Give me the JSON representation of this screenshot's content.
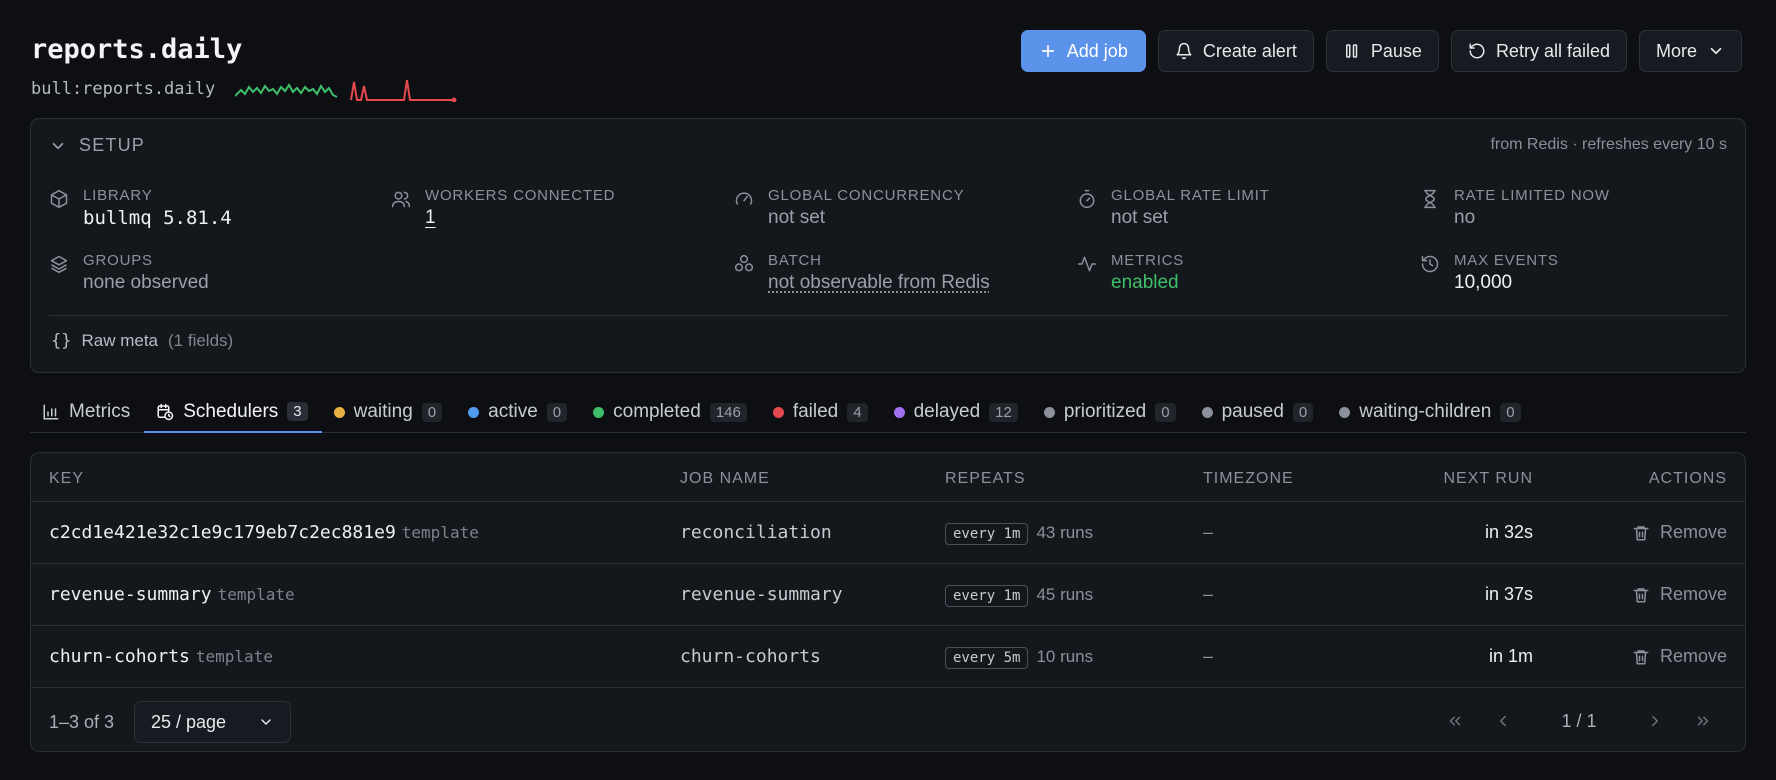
{
  "header": {
    "title": "reports.daily",
    "queue_key": "bull:reports.daily"
  },
  "actions": {
    "add_job": "Add job",
    "create_alert": "Create alert",
    "pause": "Pause",
    "retry_failed": "Retry all failed",
    "more": "More"
  },
  "setup": {
    "title": "SETUP",
    "note": "from Redis · refreshes every 10 s",
    "items": [
      {
        "label": "LIBRARY",
        "value": "bullmq 5.81.4",
        "icon": "package-icon"
      },
      {
        "label": "WORKERS CONNECTED",
        "value": "1",
        "icon": "users-icon"
      },
      {
        "label": "GLOBAL CONCURRENCY",
        "value": "not set",
        "icon": "gauge-icon"
      },
      {
        "label": "GLOBAL RATE LIMIT",
        "value": "not set",
        "icon": "timer-icon"
      },
      {
        "label": "RATE LIMITED NOW",
        "value": "no",
        "icon": "hourglass-icon"
      },
      {
        "label": "GROUPS",
        "value": "none observed",
        "icon": "layers-icon"
      },
      {
        "label": "BATCH",
        "value": "not observable from Redis",
        "icon": "boxes-icon"
      },
      {
        "label": "METRICS",
        "value": "enabled",
        "icon": "activity-icon"
      },
      {
        "label": "MAX EVENTS",
        "value": "10,000",
        "icon": "history-icon"
      }
    ],
    "raw_meta_label": "Raw meta",
    "raw_meta_count": "(1 fields)"
  },
  "tabs": [
    {
      "label": "Metrics",
      "count": null,
      "icon": "bar-chart-icon"
    },
    {
      "label": "Schedulers",
      "count": "3",
      "icon": "calendar-clock-icon",
      "selected": true
    },
    {
      "label": "waiting",
      "count": "0",
      "color": "#e8b13f"
    },
    {
      "label": "active",
      "count": "0",
      "color": "#4f9cf0"
    },
    {
      "label": "completed",
      "count": "146",
      "color": "#3fbf6a"
    },
    {
      "label": "failed",
      "count": "4",
      "color": "#e5484d"
    },
    {
      "label": "delayed",
      "count": "12",
      "color": "#a070f0"
    },
    {
      "label": "prioritized",
      "count": "0",
      "color": "#8b919b"
    },
    {
      "label": "paused",
      "count": "0",
      "color": "#8b919b"
    },
    {
      "label": "waiting-children",
      "count": "0",
      "color": "#8b919b"
    }
  ],
  "table": {
    "columns": {
      "key": "KEY",
      "job_name": "JOB NAME",
      "repeats": "REPEATS",
      "timezone": "TIMEZONE",
      "next_run": "NEXT RUN",
      "actions": "ACTIONS"
    },
    "rows": [
      {
        "key": "c2cd1e421e32c1e9c179eb7c2ec881e9",
        "tag": "template",
        "job_name": "reconciliation",
        "repeats": "every 1m",
        "runs": "43 runs",
        "timezone": "–",
        "next_run": "in 32s",
        "action": "Remove"
      },
      {
        "key": "revenue-summary",
        "tag": "template",
        "job_name": "revenue-summary",
        "repeats": "every 1m",
        "runs": "45 runs",
        "timezone": "–",
        "next_run": "in 37s",
        "action": "Remove"
      },
      {
        "key": "churn-cohorts",
        "tag": "template",
        "job_name": "churn-cohorts",
        "repeats": "every 5m",
        "runs": "10 runs",
        "timezone": "–",
        "next_run": "in 1m",
        "action": "Remove"
      }
    ],
    "footer": {
      "range": "1–3 of 3",
      "per_page": "25 / page",
      "page": "1 / 1"
    }
  },
  "colors": {
    "accent": "#5b93ea",
    "success": "#3fbf6a",
    "danger": "#e5484d"
  }
}
